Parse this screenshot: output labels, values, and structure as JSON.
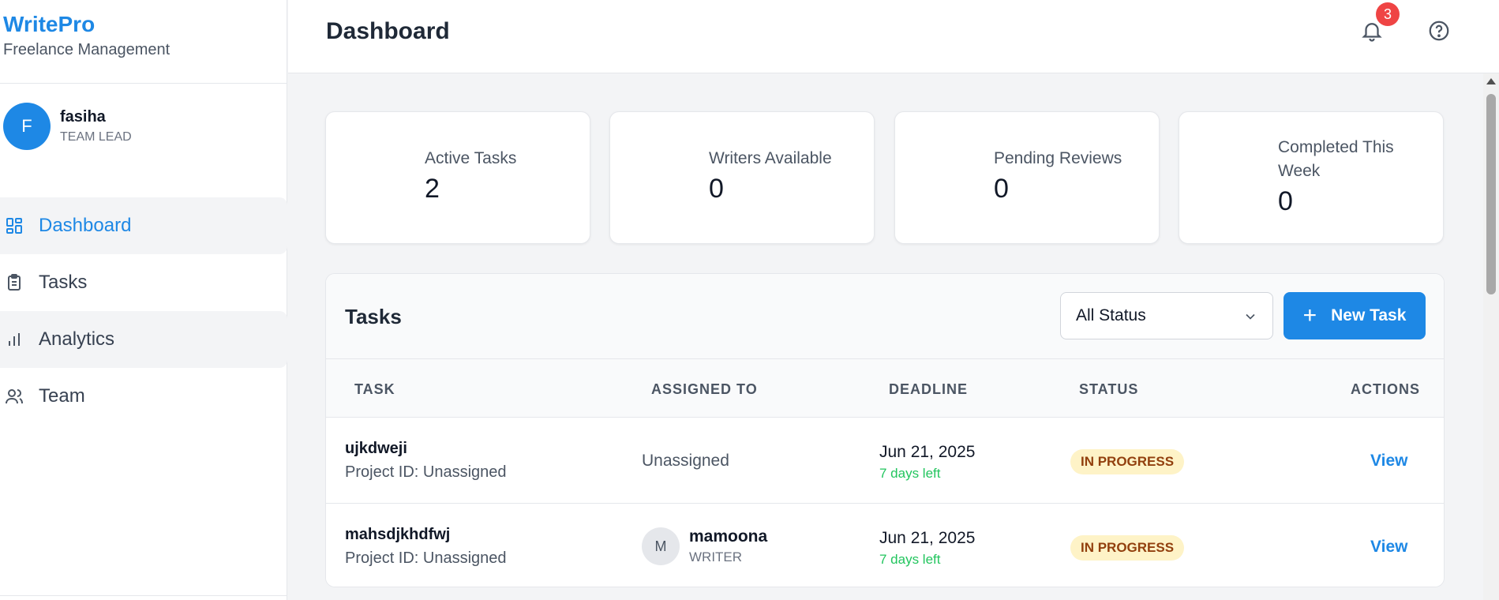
{
  "sidebar": {
    "brand_name": "WritePro",
    "brand_sub": "Freelance Management",
    "user": {
      "initial": "F",
      "name": "fasiha",
      "role": "TEAM LEAD"
    },
    "nav": [
      {
        "label": "Dashboard",
        "icon": "dashboard-grid-icon",
        "active": true
      },
      {
        "label": "Tasks",
        "icon": "clipboard-icon"
      },
      {
        "label": "Analytics",
        "icon": "bar-chart-icon"
      },
      {
        "label": "Team",
        "icon": "users-icon"
      }
    ]
  },
  "header": {
    "title": "Dashboard",
    "notification_count": "3",
    "icons": [
      "bell-icon",
      "help-circle-icon"
    ]
  },
  "stats": [
    {
      "label": "Active Tasks",
      "value": "2"
    },
    {
      "label": "Writers Available",
      "value": "0"
    },
    {
      "label": "Pending Reviews",
      "value": "0"
    },
    {
      "label": "Completed This Week",
      "value": "0"
    }
  ],
  "tasks": {
    "title": "Tasks",
    "filter_value": "All Status",
    "new_task_label": "New Task",
    "columns": [
      "TASK",
      "ASSIGNED TO",
      "DEADLINE",
      "STATUS",
      "ACTIONS"
    ],
    "rows": [
      {
        "name": "ujkdweji",
        "project": "Project ID: Unassigned",
        "assigned": "Unassigned",
        "deadline": "Jun 21, 2025",
        "days_left": "7 days left",
        "status": "IN PROGRESS",
        "action": "View"
      },
      {
        "name": "mahsdjkhdfwj",
        "project": "Project ID: Unassigned",
        "assignee_initial": "M",
        "assignee_name": "mamoona",
        "assignee_role": "WRITER",
        "deadline": "Jun 21, 2025",
        "days_left": "7 days left",
        "status": "IN PROGRESS",
        "action": "View"
      }
    ]
  },
  "colors": {
    "accent": "#1e88e5",
    "badge": "#ef4444",
    "status_bg": "#fef3c7",
    "status_text": "#92400e",
    "days_left": "#22c55e"
  }
}
